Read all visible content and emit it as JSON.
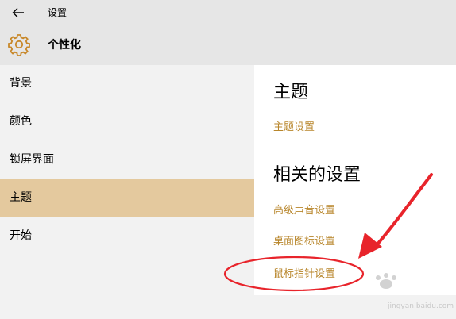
{
  "window": {
    "title": "设置"
  },
  "header": {
    "title": "个性化"
  },
  "sidebar": {
    "items": [
      {
        "label": "背景",
        "active": false
      },
      {
        "label": "颜色",
        "active": false
      },
      {
        "label": "锁屏界面",
        "active": false
      },
      {
        "label": "主题",
        "active": true
      },
      {
        "label": "开始",
        "active": false
      }
    ]
  },
  "main": {
    "theme_heading": "主题",
    "theme_settings_link": "主题设置",
    "related_heading": "相关的设置",
    "related_links": [
      "高级声音设置",
      "桌面图标设置",
      "鼠标指针设置"
    ]
  },
  "watermark": {
    "text": "jingyan.baidu.com"
  },
  "colors": {
    "accent": "#b8862b",
    "active_item": "#e4c99e",
    "annotation": "#e8242b",
    "titlebar": "#e6e6e6"
  },
  "icons": {
    "back": "back-arrow-icon",
    "personalization": "gear-icon"
  }
}
